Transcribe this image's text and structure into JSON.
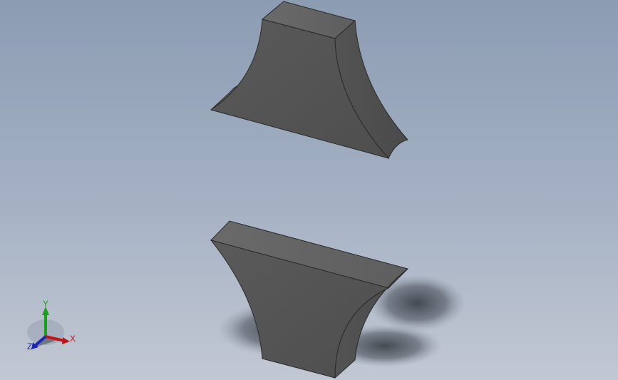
{
  "viewport": {
    "background_top": "#8c9cb2",
    "background_bottom": "#c2c8d3",
    "part_color": "#565656",
    "shadow_color": "#4a4f58"
  },
  "triad": {
    "x_label": "X",
    "y_label": "Y",
    "z_label": "Z",
    "x_color": "#c0141a",
    "y_color": "#1aa01a",
    "z_color": "#1a28b4"
  }
}
